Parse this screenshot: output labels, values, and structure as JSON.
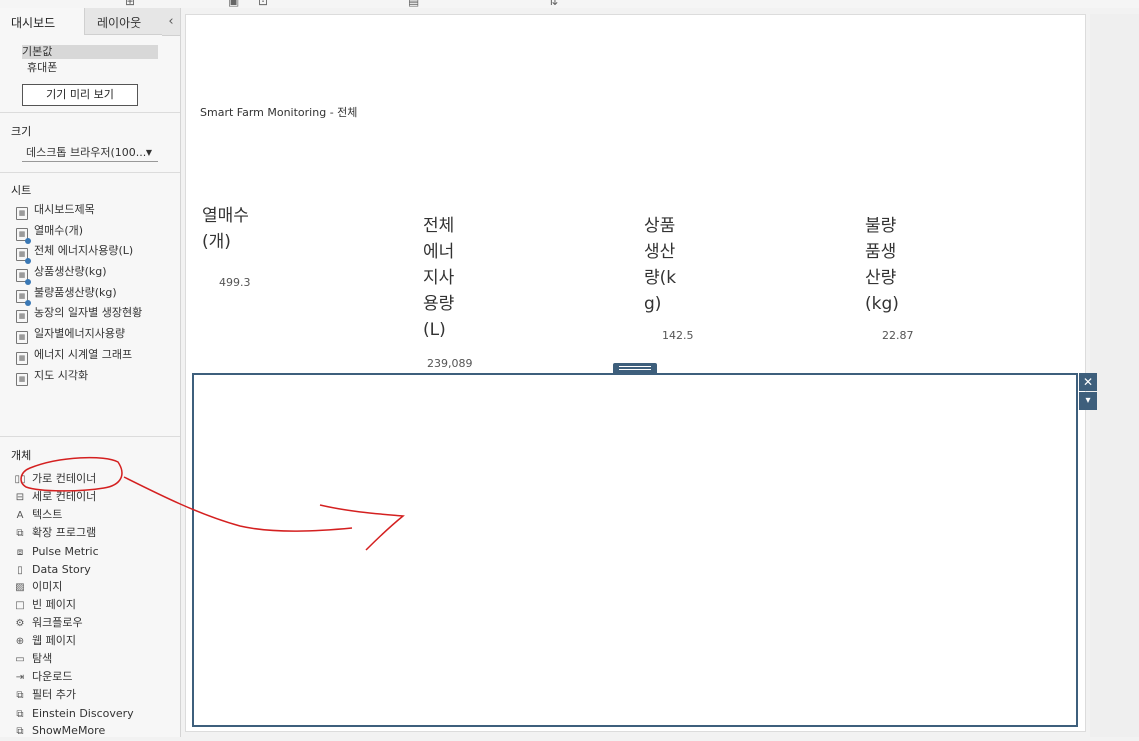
{
  "left_pane": {
    "tabs": [
      "대시보드",
      "레이아웃"
    ],
    "collapse_icon": "chevron-left-icon",
    "devices": [
      "기본값",
      "휴대폰"
    ],
    "device_preview_button": "기기 미리 보기",
    "size_section": "크기",
    "size_value": "데스크톱 브라우저(100...",
    "sheets_section": "시트",
    "sheets": [
      {
        "label": "대시보드제목",
        "in_use": false
      },
      {
        "label": "열매수(개)",
        "in_use": true
      },
      {
        "label": "전체 에너지사용량(L)",
        "in_use": true
      },
      {
        "label": "상품생산량(kg)",
        "in_use": true
      },
      {
        "label": "불량품생산량(kg)",
        "in_use": true
      },
      {
        "label": "농장의 일자별 생장현황",
        "in_use": false
      },
      {
        "label": "일자별에너지사용량",
        "in_use": false
      },
      {
        "label": "에너지 시계열 그래프",
        "in_use": false
      },
      {
        "label": "지도 시각화",
        "in_use": false
      }
    ],
    "objects_section": "개체",
    "objects": [
      {
        "label": "가로 컨테이너",
        "icon": "horizontal-container-icon"
      },
      {
        "label": "세로 컨테이너",
        "icon": "vertical-container-icon"
      },
      {
        "label": "텍스트",
        "icon": "text-icon"
      },
      {
        "label": "확장 프로그램",
        "icon": "extension-icon"
      },
      {
        "label": "Pulse Metric",
        "icon": "pulse-metric-icon"
      },
      {
        "label": "Data Story",
        "icon": "data-story-icon"
      },
      {
        "label": "이미지",
        "icon": "image-icon"
      },
      {
        "label": "빈 페이지",
        "icon": "blank-icon"
      },
      {
        "label": "워크플로우",
        "icon": "workflow-icon"
      },
      {
        "label": "웹 페이지",
        "icon": "web-page-icon"
      },
      {
        "label": "탐색",
        "icon": "navigation-icon"
      },
      {
        "label": "다운로드",
        "icon": "download-icon"
      },
      {
        "label": "필터 추가",
        "icon": "extension-icon"
      },
      {
        "label": "Einstein Discovery",
        "icon": "extension-icon"
      },
      {
        "label": "ShowMeMore",
        "icon": "extension-icon"
      }
    ]
  },
  "dashboard": {
    "title": "Smart Farm Monitoring - 전체",
    "kpis": [
      {
        "title": "열매수(개)",
        "value": "499.3"
      },
      {
        "title": "전체에너지사용량(L)",
        "value": "239,089"
      },
      {
        "title": "상품생산량(kg)",
        "value": "142.5"
      },
      {
        "title": "불량품생산량(kg)",
        "value": "22.87"
      }
    ],
    "container_close": "✕",
    "container_menu": "▾"
  },
  "annotation_color": "#d42020",
  "accent_color": "#3e5f7c"
}
